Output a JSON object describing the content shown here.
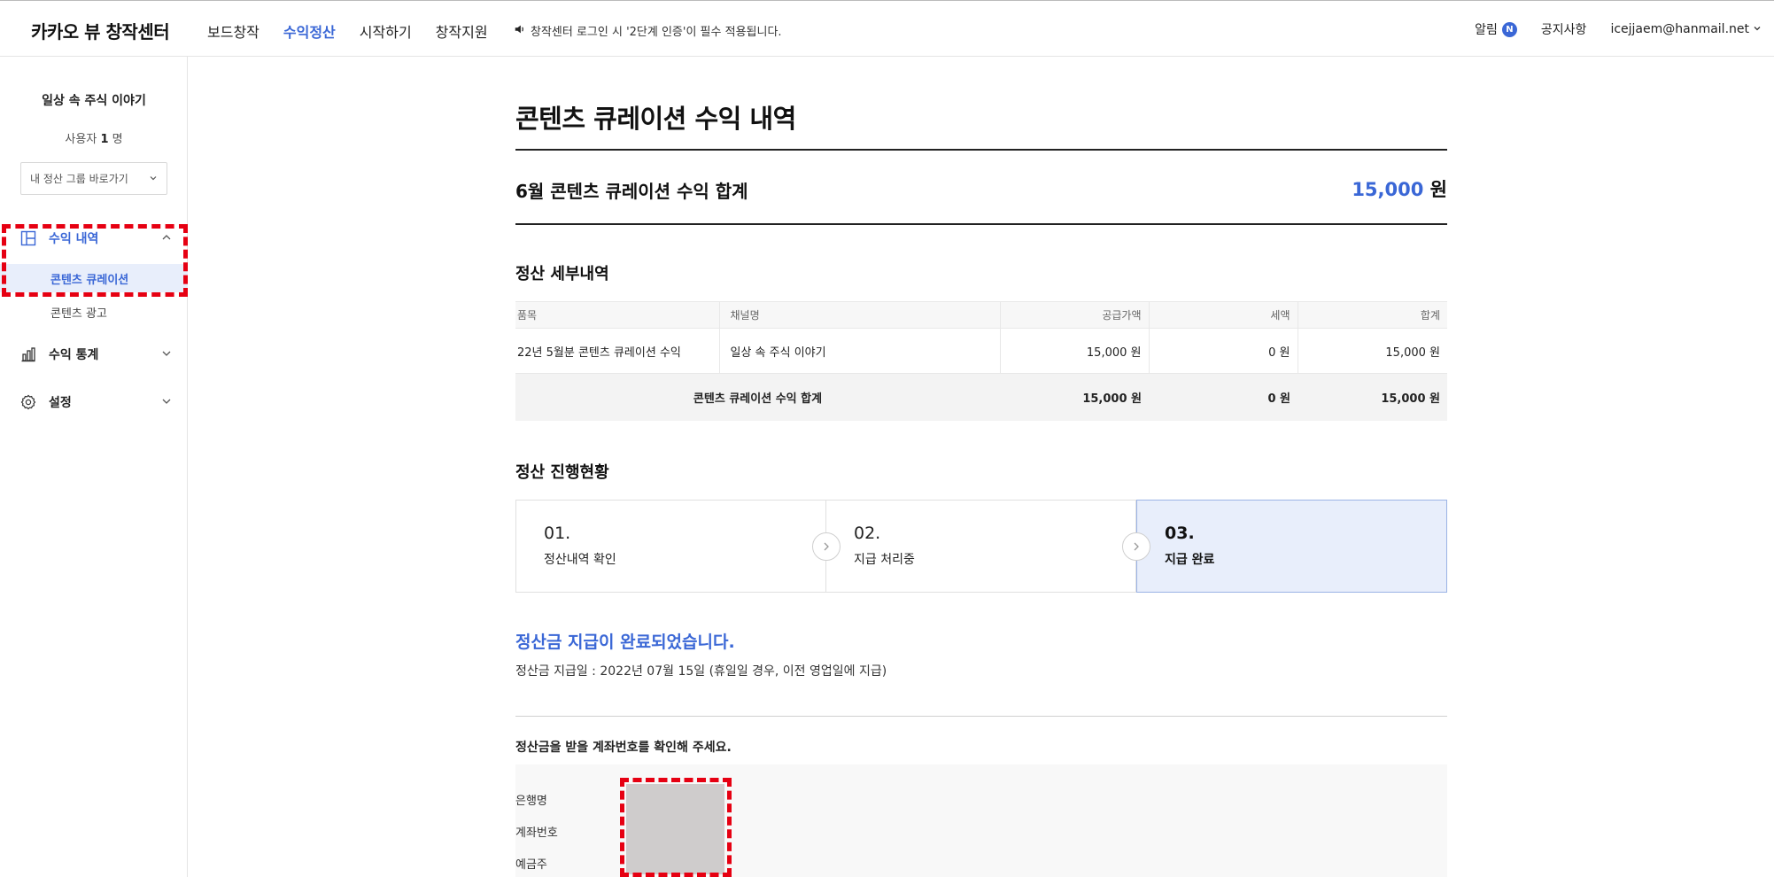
{
  "header": {
    "logo": "카카오 뷰 창작센터",
    "nav": [
      "보드창작",
      "수익정산",
      "시작하기",
      "창작지원"
    ],
    "notice": "창작센터 로그인 시 '2단계 인증'이 필수 적용됩니다.",
    "alarm_label": "알림",
    "alarm_badge": "N",
    "notice_board": "공지사항",
    "account": "icejjaem@hanmail.net"
  },
  "sidebar": {
    "channel_name": "일상 속 주식 이야기",
    "user_prefix": "사용자",
    "user_count": "1",
    "user_suffix": "명",
    "group_select": "내 정산 그룹 바로가기",
    "menu_revenue": "수익 내역",
    "sub_curation": "콘텐츠 큐레이션",
    "sub_ads": "콘텐츠 광고",
    "menu_stats": "수익 통계",
    "menu_settings": "설정"
  },
  "main": {
    "title": "콘텐츠 큐레이션 수익 내역",
    "summary_label": "6월 콘텐츠 큐레이션 수익 합계",
    "summary_value": "15,000",
    "summary_unit": "원",
    "detail_title": "정산 세부내역",
    "table": {
      "headers": [
        "품목",
        "채널명",
        "공급가액",
        "세액",
        "합계"
      ],
      "row": [
        "22년 5월분 콘텐츠 큐레이션 수익",
        "일상 속 주식 이야기",
        "15,000 원",
        "0 원",
        "15,000 원"
      ],
      "total": [
        "콘텐츠 큐레이션 수익 합계",
        "15,000 원",
        "0 원",
        "15,000 원"
      ]
    },
    "progress_title": "정산 진행현황",
    "steps": [
      {
        "no": "01.",
        "label": "정산내역 확인"
      },
      {
        "no": "02.",
        "label": "지급 처리중"
      },
      {
        "no": "03.",
        "label": "지급 완료"
      }
    ],
    "done_message": "정산금 지급이 완료되었습니다.",
    "pay_date": "정산금 지급일 : 2022년 07월 15일 (휴일일 경우, 이전 영업일에 지급)",
    "account_title": "정산금을 받을 계좌번호를 확인해 주세요.",
    "account_labels": [
      "은행명",
      "계좌번호",
      "예금주"
    ]
  }
}
